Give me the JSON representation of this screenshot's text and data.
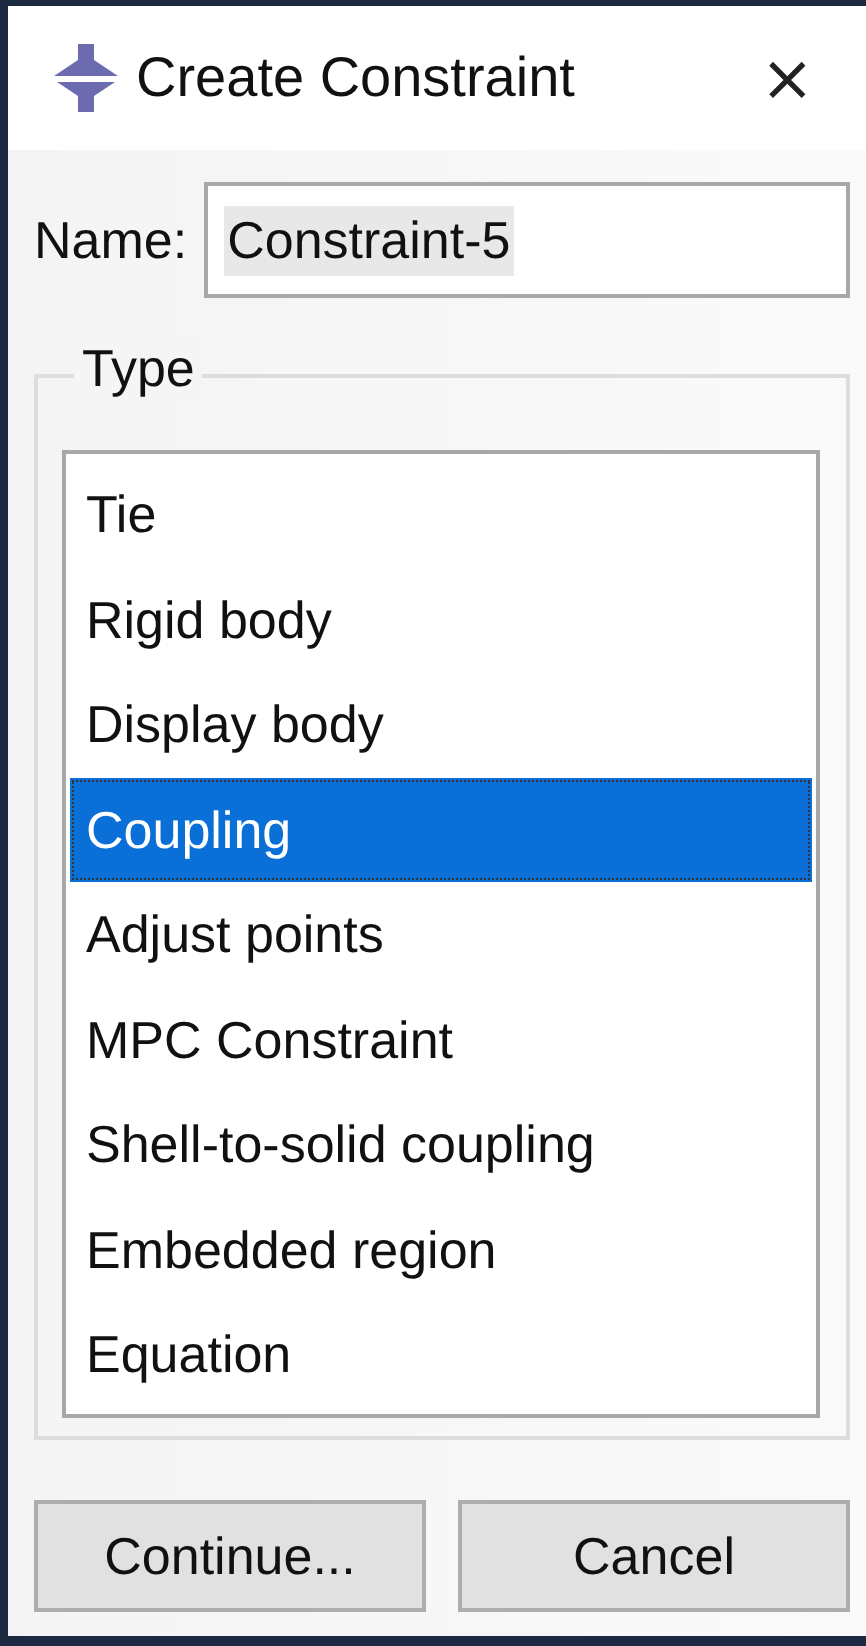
{
  "window": {
    "title": "Create Constraint",
    "close": "×"
  },
  "name_field": {
    "label": "Name:",
    "value": "Constraint-5"
  },
  "type_group": {
    "title": "Type",
    "items": [
      {
        "label": "Tie",
        "selected": false
      },
      {
        "label": "Rigid body",
        "selected": false
      },
      {
        "label": "Display body",
        "selected": false
      },
      {
        "label": "Coupling",
        "selected": true
      },
      {
        "label": "Adjust points",
        "selected": false
      },
      {
        "label": "MPC Constraint",
        "selected": false
      },
      {
        "label": "Shell-to-solid coupling",
        "selected": false
      },
      {
        "label": "Embedded region",
        "selected": false
      },
      {
        "label": "Equation",
        "selected": false
      }
    ]
  },
  "buttons": [
    "Continue...",
    "Cancel"
  ]
}
